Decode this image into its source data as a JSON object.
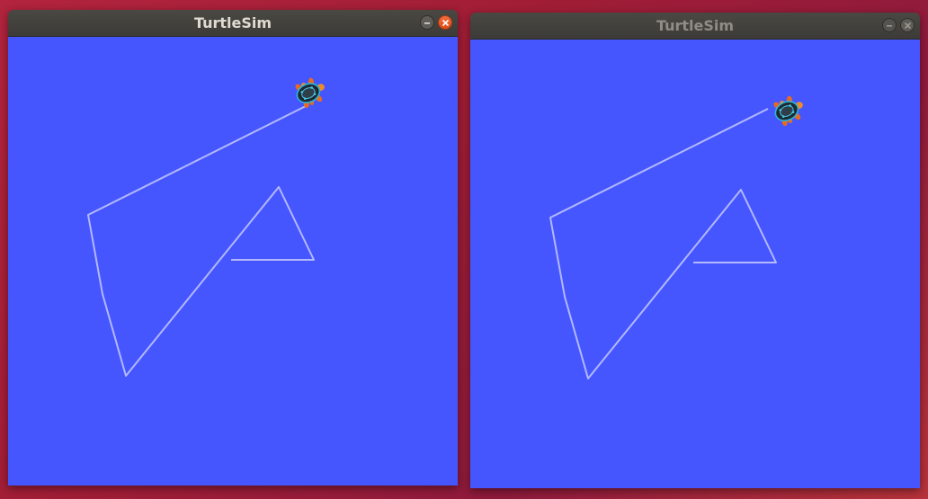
{
  "windows": [
    {
      "id": "left",
      "title": "TurtleSim",
      "active": true,
      "background_color": "#4556ff",
      "path_color": "#b3b8ff",
      "turtle_icon": "turtle-icon"
    },
    {
      "id": "right",
      "title": "TurtleSim",
      "active": false,
      "background_color": "#4556ff",
      "path_color": "#b3b8ff",
      "turtle_icon": "turtle-icon"
    }
  ],
  "controls": {
    "minimize_icon": "minimize-icon",
    "close_icon": "close-icon"
  },
  "colors": {
    "canvas": "#4556ff",
    "trail": "#b3b8ff",
    "titlebar": "#3c3b37",
    "close_active": "#e95420"
  }
}
